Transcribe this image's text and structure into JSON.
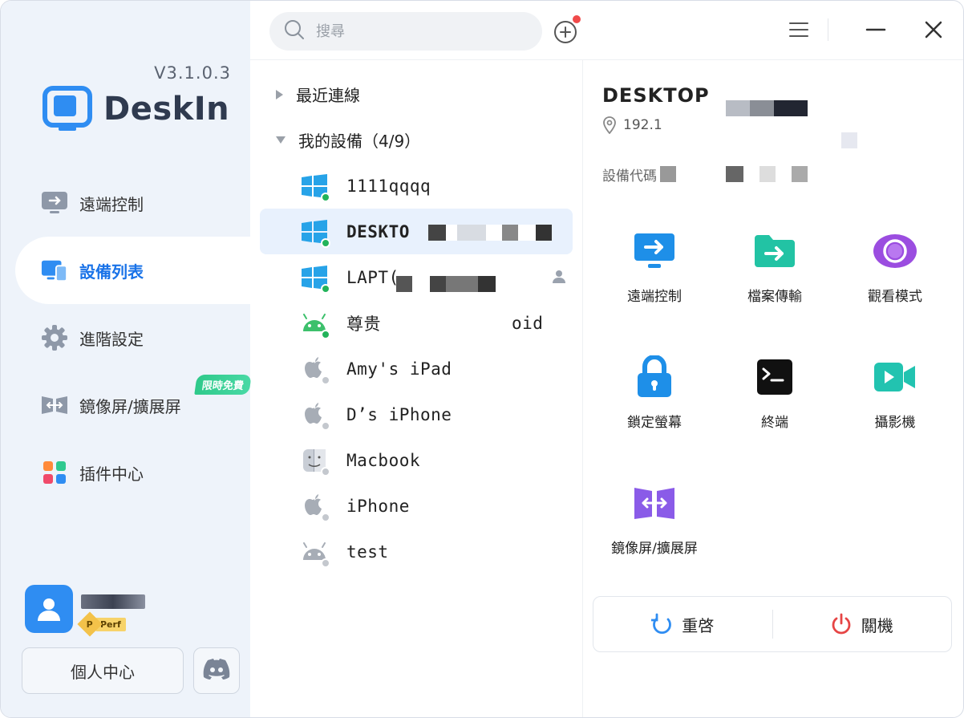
{
  "app": {
    "version": "V3.1.0.3",
    "logo_text": "DeskIn"
  },
  "sidebar": {
    "items": [
      {
        "label": "遠端控制",
        "icon": "monitor-arrow-icon"
      },
      {
        "label": "設備列表",
        "icon": "devices-icon",
        "active": true
      },
      {
        "label": "進階設定",
        "icon": "gear-icon"
      },
      {
        "label": "鏡像屏/擴展屏",
        "icon": "mirror-screen-icon",
        "badge": "限時免費"
      },
      {
        "label": "插件中心",
        "icon": "plugin-grid-icon"
      }
    ],
    "user": {
      "tier_letter": "P",
      "tier_label": "Perf"
    },
    "personal_center": "個人中心"
  },
  "topbar": {
    "search_placeholder": "搜尋"
  },
  "device_list": {
    "recent_label": "最近連線",
    "my_devices_label": "我的設備（4/9）",
    "devices": [
      {
        "name": "1111qqqq",
        "os": "windows",
        "online": true
      },
      {
        "name": "DESKTO",
        "os": "windows",
        "online": true,
        "selected": true
      },
      {
        "name": "LAPT(",
        "os": "windows",
        "online": true,
        "shared": true
      },
      {
        "name": "尊贵",
        "name_suffix": "oid",
        "os": "android",
        "online": true
      },
      {
        "name": "Amy's iPad",
        "os": "apple",
        "online": false
      },
      {
        "name": "D’s iPhone",
        "os": "apple",
        "online": false
      },
      {
        "name": "Macbook",
        "os": "finder",
        "online": false
      },
      {
        "name": "iPhone",
        "os": "apple",
        "online": false
      },
      {
        "name": "test",
        "os": "android",
        "online": false
      }
    ]
  },
  "detail": {
    "title": "DESKTOP",
    "ip": "192.1",
    "device_code_label": "設備代碼",
    "actions": [
      {
        "label": "遠端控制",
        "icon": "remote-control-icon",
        "color": "#1e8fe8"
      },
      {
        "label": "檔案傳輸",
        "icon": "file-transfer-icon",
        "color": "#22c3a4"
      },
      {
        "label": "觀看模式",
        "icon": "view-mode-icon",
        "color": "#9b4de0"
      },
      {
        "label": "鎖定螢幕",
        "icon": "lock-screen-icon",
        "color": "#1e8fe8"
      },
      {
        "label": "終端",
        "icon": "terminal-icon",
        "color": "#111111"
      },
      {
        "label": "攝影機",
        "icon": "camera-icon",
        "color": "#22c3b0"
      },
      {
        "label": "鏡像屏/擴展屏",
        "icon": "mirror-extend-icon",
        "color": "#8a5be8"
      }
    ],
    "restart_label": "重啓",
    "shutdown_label": "關機"
  },
  "colors": {
    "accent": "#1a73e8",
    "sidebar_bg": "#eef3fa",
    "online": "#22b35a",
    "shutdown": "#e64545",
    "restart": "#2f8df2"
  }
}
